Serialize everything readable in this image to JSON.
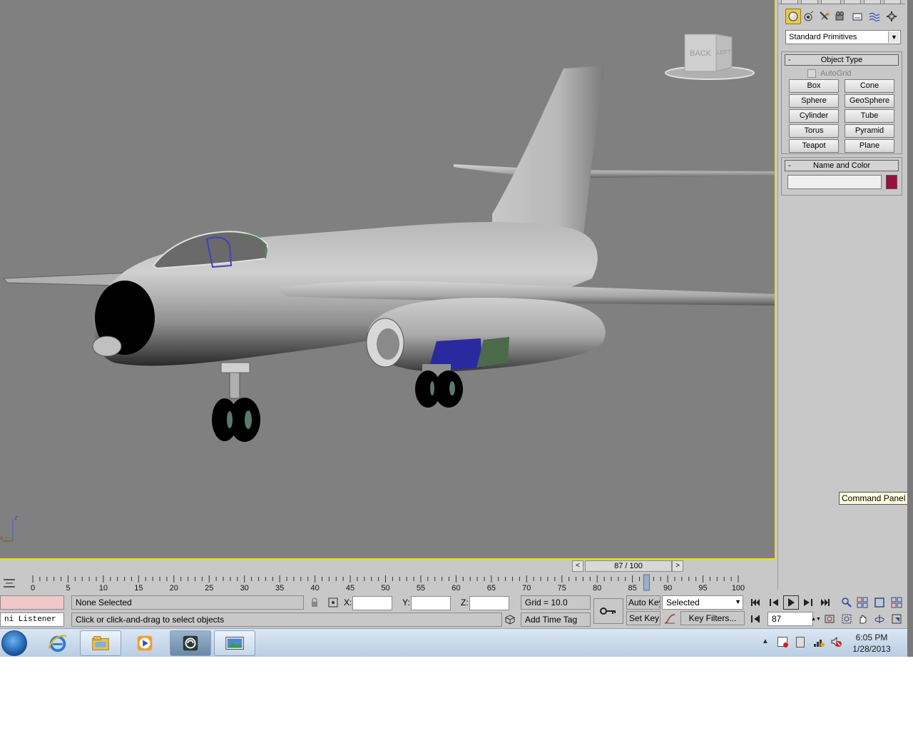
{
  "viewport": {
    "viewcube_faces": [
      "BACK",
      "LEFT"
    ],
    "axis_labels": {
      "z": "z",
      "x": "x",
      "y": "y"
    },
    "active_border_color": "#e8e000",
    "background_color": "#808080"
  },
  "command_panel": {
    "icons": [
      "sphere-icon",
      "lights-icon",
      "cameras-icon",
      "helpers-icon",
      "shapes-icon",
      "spacewarps-icon",
      "systems-icon"
    ],
    "category_dropdown": "Standard Primitives",
    "object_type": {
      "title": "Object Type",
      "collapse": "-",
      "autogrid_label": "AutoGrid",
      "buttons": [
        "Box",
        "Cone",
        "Sphere",
        "GeoSphere",
        "Cylinder",
        "Tube",
        "Torus",
        "Pyramid",
        "Teapot",
        "Plane"
      ]
    },
    "name_and_color": {
      "title": "Name and Color",
      "collapse": "-",
      "name_value": "",
      "color": "#9a1040"
    },
    "tooltip": "Command Panel"
  },
  "timeline": {
    "slider_label": "87 / 100",
    "prev_arrow": "<",
    "next_arrow": ">",
    "current_frame": 87,
    "total_frames": 100,
    "tick_labels": [
      "0",
      "5",
      "10",
      "15",
      "20",
      "25",
      "30",
      "35",
      "40",
      "45",
      "50",
      "55",
      "60",
      "65",
      "70",
      "75",
      "80",
      "85",
      "90",
      "95",
      "100"
    ]
  },
  "status": {
    "selection": "None Selected",
    "prompt": "Click or click-and-drag to select objects",
    "listener": "ni Listener",
    "x_label": "X:",
    "y_label": "Y:",
    "z_label": "Z:",
    "x_value": "",
    "y_value": "",
    "z_value": "",
    "grid": "Grid = 10.0",
    "add_time_tag": "Add Time Tag",
    "auto_key": "Auto Key",
    "set_key": "Set Key",
    "selected_dropdown": "Selected",
    "key_filters": "Key Filters...",
    "frame_field": "87"
  },
  "taskbar": {
    "apps": [
      "ie-icon",
      "explorer-icon",
      "media-player-icon",
      "3dsmax-icon",
      "photo-viewer-icon"
    ],
    "time": "6:05 PM",
    "date": "1/28/2013"
  }
}
